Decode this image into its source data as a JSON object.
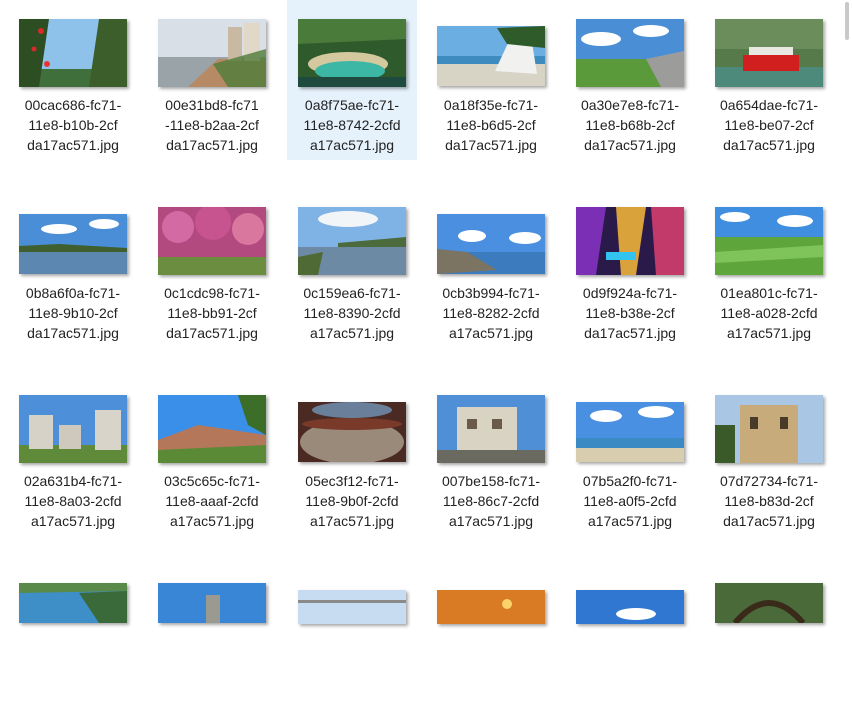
{
  "files": [
    {
      "line1": "00cac686-fc71-",
      "line2": "11e8-b10b-2cf",
      "line3": "da17ac571.jpg",
      "icon": "photo-flowers-sky"
    },
    {
      "line1": "00e31bd8-fc71",
      "line2": "-11e8-b2aa-2cf",
      "line3": "da17ac571.jpg",
      "icon": "photo-seaside-promenade"
    },
    {
      "line1": "0a8f75ae-fc71-",
      "line2": "11e8-8742-2cfd",
      "line3": "a17ac571.jpg",
      "icon": "photo-green-lagoon"
    },
    {
      "line1": "0a18f35e-fc71-",
      "line2": "11e8-b6d5-2cf",
      "line3": "da17ac571.jpg",
      "icon": "photo-boat-beach"
    },
    {
      "line1": "0a30e7e8-fc71-",
      "line2": "11e8-b68b-2cf",
      "line3": "da17ac571.jpg",
      "icon": "photo-park-lawn"
    },
    {
      "line1": "0a654dae-fc71-",
      "line2": "11e8-be07-2cf",
      "line3": "da17ac571.jpg",
      "icon": "photo-red-boat"
    },
    {
      "line1": "0b8a6f0a-fc71-",
      "line2": "11e8-9b10-2cf",
      "line3": "da17ac571.jpg",
      "icon": "photo-lake-sky"
    },
    {
      "line1": "0c1cdc98-fc71-",
      "line2": "11e8-bb91-2cf",
      "line3": "da17ac571.jpg",
      "icon": "photo-pink-blossoms"
    },
    {
      "line1": "0c159ea6-fc71-",
      "line2": "11e8-8390-2cfd",
      "line3": "a17ac571.jpg",
      "icon": "photo-lakeshore"
    },
    {
      "line1": "0cb3b994-fc71-",
      "line2": "11e8-8282-2cfd",
      "line3": "a17ac571.jpg",
      "icon": "photo-rocky-coast"
    },
    {
      "line1": "0d9f924a-fc71-",
      "line2": "11e8-b38e-2cf",
      "line3": "da17ac571.jpg",
      "icon": "photo-colorful-cave"
    },
    {
      "line1": "01ea801c-fc71-",
      "line2": "11e8-a028-2cfd",
      "line3": "a17ac571.jpg",
      "icon": "photo-grassland"
    },
    {
      "line1": "02a631b4-fc71-",
      "line2": "11e8-8a03-2cfd",
      "line3": "a17ac571.jpg",
      "icon": "photo-watchtowers"
    },
    {
      "line1": "03c5c65c-fc71-",
      "line2": "11e8-aaaf-2cfd",
      "line3": "a17ac571.jpg",
      "icon": "photo-hillside-trees"
    },
    {
      "line1": "05ec3f12-fc71-",
      "line2": "11e8-9b0f-2cfd",
      "line3": "a17ac571.jpg",
      "icon": "photo-tulou-courtyard"
    },
    {
      "line1": "007be158-fc71-",
      "line2": "11e8-86c7-2cfd",
      "line3": "a17ac571.jpg",
      "icon": "photo-old-building"
    },
    {
      "line1": "07b5a2f0-fc71-",
      "line2": "11e8-a0f5-2cfd",
      "line3": "a17ac571.jpg",
      "icon": "photo-crowded-beach"
    },
    {
      "line1": "07d72734-fc71-",
      "line2": "11e8-b83d-2cf",
      "line3": "da17ac571.jpg",
      "icon": "photo-european-villa"
    },
    {
      "line1": "",
      "line2": "",
      "line3": "",
      "icon": "photo-bay-aerial"
    },
    {
      "line1": "",
      "line2": "",
      "line3": "",
      "icon": "photo-blue-sky-tower"
    },
    {
      "line1": "",
      "line2": "",
      "line3": "",
      "icon": "photo-bridge-sky"
    },
    {
      "line1": "",
      "line2": "",
      "line3": "",
      "icon": "photo-sunset"
    },
    {
      "line1": "",
      "line2": "",
      "line3": "",
      "icon": "photo-sky-clouds"
    },
    {
      "line1": "",
      "line2": "",
      "line3": "",
      "icon": "photo-garden-arch"
    }
  ]
}
